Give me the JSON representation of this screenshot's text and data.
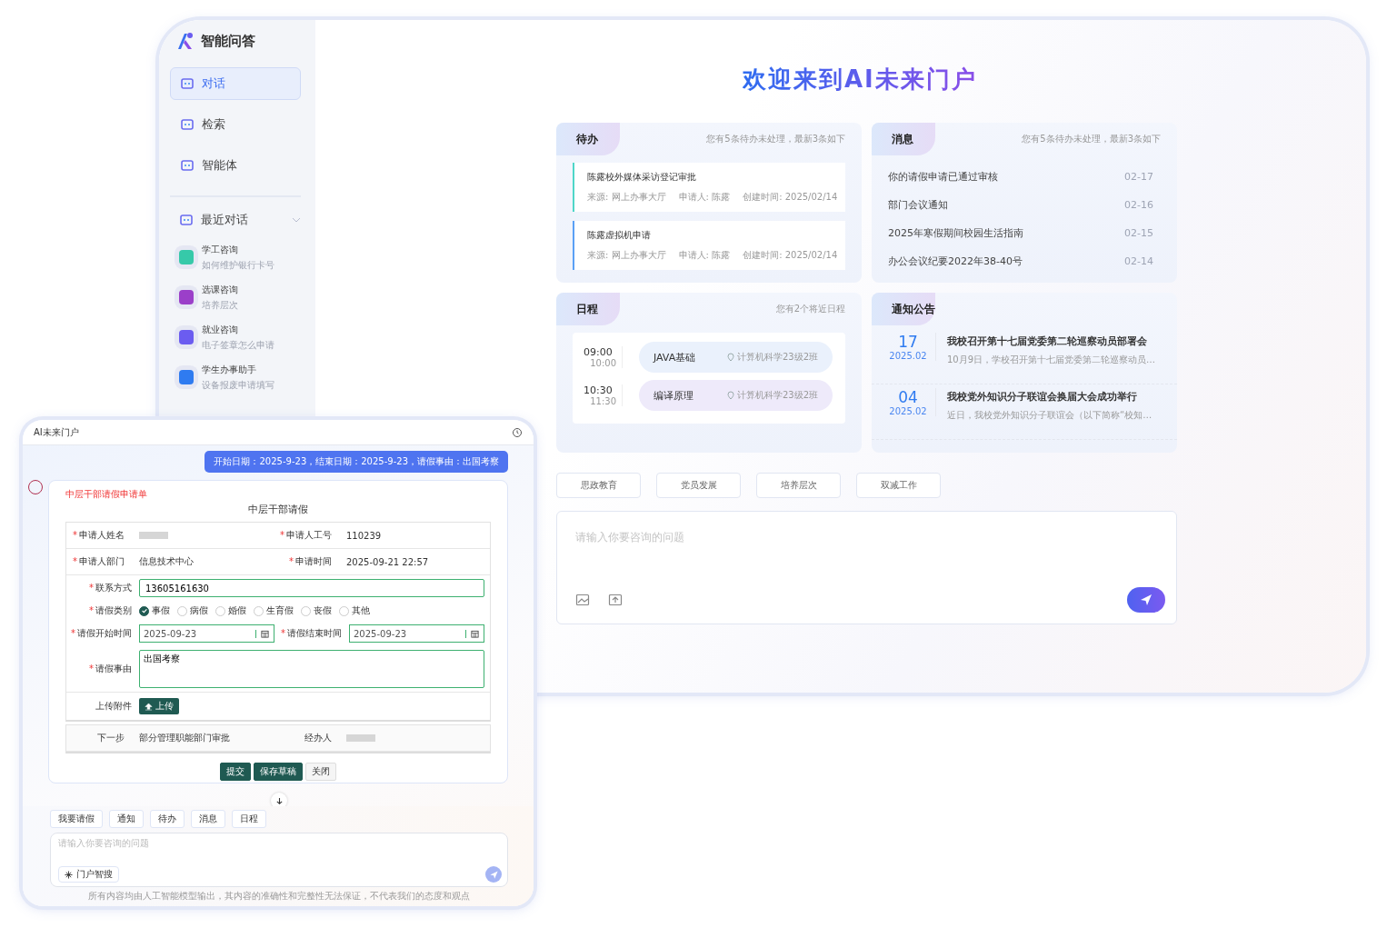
{
  "main_window": {
    "sidebar": {
      "app_title": "智能问答",
      "nav": [
        {
          "label": "对话",
          "selected": true
        },
        {
          "label": "检索",
          "selected": false
        },
        {
          "label": "智能体",
          "selected": false
        }
      ],
      "recent": {
        "title": "最近对话",
        "items": [
          {
            "title": "学工咨询",
            "subtitle": "如何维护银行卡号",
            "color": "#36c9a9"
          },
          {
            "title": "选课咨询",
            "subtitle": "培养层次",
            "color": "#9b3fc9"
          },
          {
            "title": "就业咨询",
            "subtitle": "电子签章怎么申请",
            "color": "#6b5cf0"
          },
          {
            "title": "学生办事助手",
            "subtitle": "设备报废申请填写",
            "color": "#2f7bf0"
          }
        ]
      }
    },
    "heading": "欢迎来到AI未来门户",
    "todo": {
      "title": "待办",
      "summary": "您有5条待办未处理，最新3条如下",
      "items": [
        {
          "title": "陈露校外媒体采访登记审批",
          "source": "来源: 网上办事大厅",
          "applicant": "申请人: 陈露",
          "created": "创建时间: 2025/02/14",
          "color": "#4fd6c8"
        },
        {
          "title": "陈露虚拟机申请",
          "source": "来源: 网上办事大厅",
          "applicant": "申请人: 陈露",
          "created": "创建时间: 2025/02/14",
          "color": "#5aa0f5"
        }
      ]
    },
    "messages": {
      "title": "消息",
      "summary": "您有5条待办未处理，最新3条如下",
      "items": [
        {
          "text": "你的请假申请已通过审核",
          "date": "02-17"
        },
        {
          "text": "部门会议通知",
          "date": "02-16"
        },
        {
          "text": "2025年寒假期间校园生活指南",
          "date": "02-15"
        },
        {
          "text": "办公会议纪要2022年38-40号",
          "date": "02-14"
        }
      ]
    },
    "schedule": {
      "title": "日程",
      "summary": "您有2个将近日程",
      "items": [
        {
          "start": "09:00",
          "end": "10:00",
          "course": "JAVA基础",
          "location": "计算机科学23级2班",
          "color": "#eaf1fc"
        },
        {
          "start": "10:30",
          "end": "11:30",
          "course": "编译原理",
          "location": "计算机科学23级2班",
          "color": "#eeeafa"
        }
      ]
    },
    "notices": {
      "title": "通知公告",
      "items": [
        {
          "day": "17",
          "month": "2025.02",
          "title": "我校召开第十七届党委第二轮巡察动员部署会",
          "summary": "10月9日，学校召开第十七届党委第二轮巡察动员…"
        },
        {
          "day": "04",
          "month": "2025.02",
          "title": "我校党外知识分子联谊会换届大会成功举行",
          "summary": "近日，我校党外知识分子联谊会（以下简称“校知…"
        }
      ]
    },
    "quick_tags": [
      "思政教育",
      "党员发展",
      "培养层次",
      "双减工作"
    ],
    "composer": {
      "placeholder": "请输入你要咨询的问题"
    }
  },
  "chat_window": {
    "title": "AI未来门户",
    "user_message": "开始日期：2025-9-23，结束日期：2025-9-23，请假事由：出国考察",
    "form": {
      "note": "中层干部请假申请单",
      "title": "中层干部请假",
      "applicant_name": {
        "mark": "*",
        "label": "申请人姓名"
      },
      "employee_id": {
        "mark": "*",
        "label": "申请人工号",
        "value": "110239"
      },
      "department": {
        "mark": "*",
        "label": "申请人部门",
        "value": "信息技术中心"
      },
      "apply_time": {
        "mark": "*",
        "label": "申请时间",
        "value": "2025-09-21 22:57"
      },
      "contact": {
        "mark": "*",
        "label": "联系方式",
        "value": "13605161630"
      },
      "leave_type": {
        "mark": "*",
        "label": "请假类别",
        "options": [
          {
            "label": "事假",
            "selected": true
          },
          {
            "label": "病假",
            "selected": false
          },
          {
            "label": "婚假",
            "selected": false
          },
          {
            "label": "生育假",
            "selected": false
          },
          {
            "label": "丧假",
            "selected": false
          },
          {
            "label": "其他",
            "selected": false
          }
        ]
      },
      "start": {
        "mark": "*",
        "label": "请假开始时间",
        "value": "2025-09-23"
      },
      "end": {
        "mark": "*",
        "label": "请假结束时间",
        "value": "2025-09-23"
      },
      "reason": {
        "mark": "*",
        "label": "请假事由",
        "value": "出国考察"
      },
      "attachment": {
        "label": "上传附件",
        "button": "上传"
      },
      "next_step": {
        "label": "下一步",
        "value": "部分管理职能部门审批"
      },
      "handler": {
        "label": "经办人"
      },
      "buttons": [
        "提交",
        "保存草稿",
        "关闭"
      ]
    },
    "quick_tags": [
      "我要请假",
      "通知",
      "待办",
      "消息",
      "日程"
    ],
    "composer": {
      "placeholder": "请输入你要咨询的问题",
      "tool": "门户智搜"
    },
    "disclaimer": "所有内容均由人工智能模型输出，其内容的准确性和完整性无法保证，不代表我们的态度和观点"
  }
}
